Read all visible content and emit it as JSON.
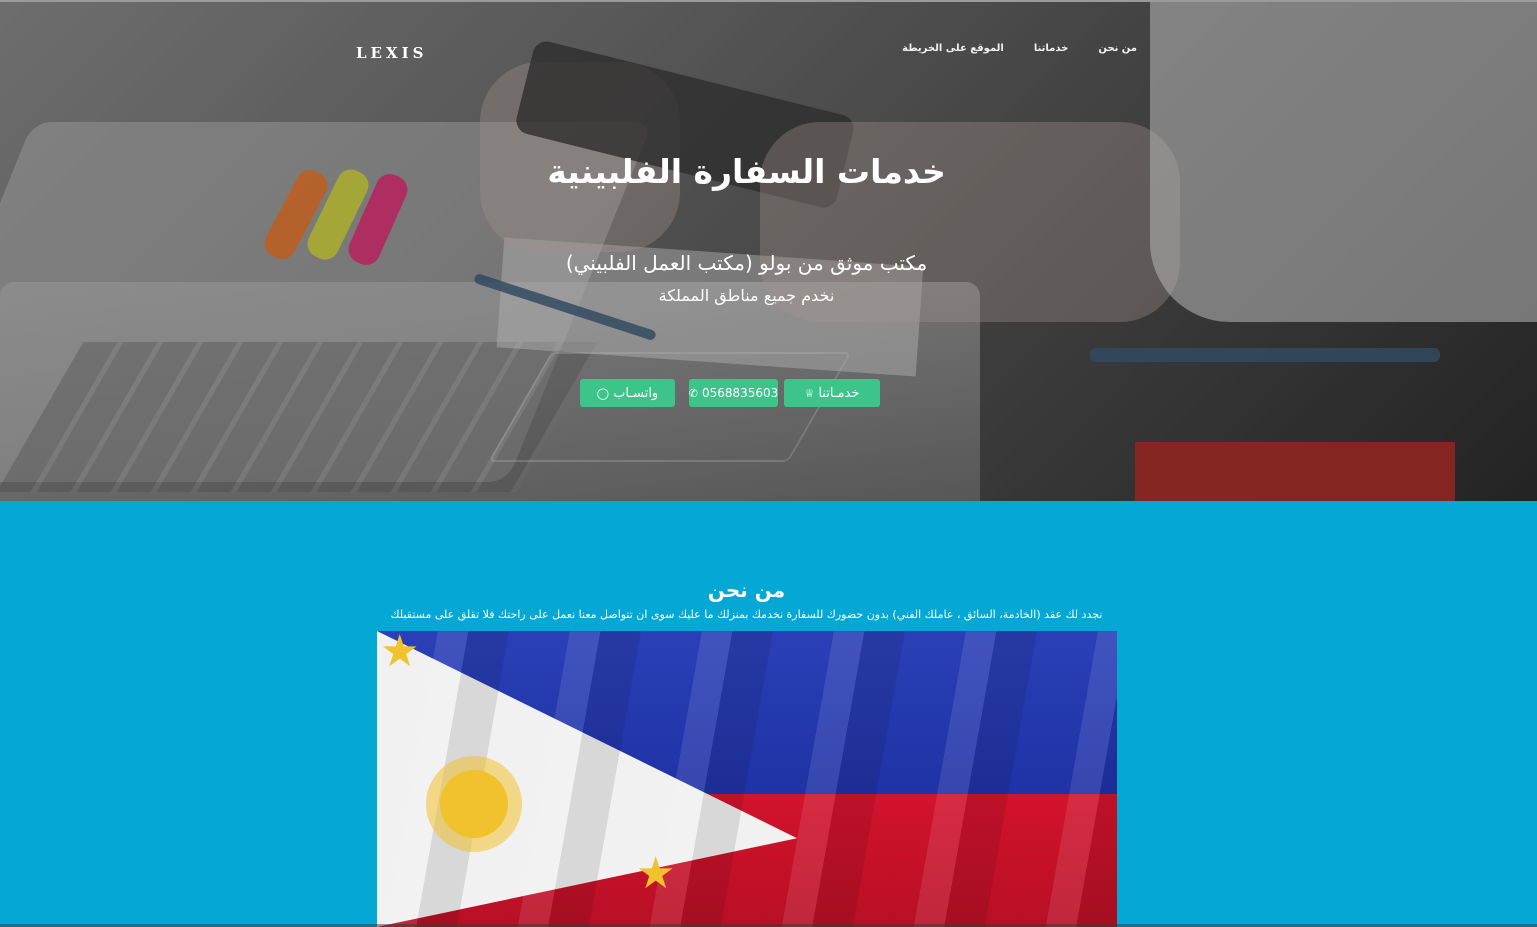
{
  "header": {
    "brand": "LEXIS",
    "nav": [
      {
        "label": "من نحن"
      },
      {
        "label": "خدماتنا"
      },
      {
        "label": "الموقع على الخريطة"
      }
    ]
  },
  "hero": {
    "title": "خدمات السفارة الفلبينية",
    "subtitle": "مكتب موثق من بولو (مكتب العمل الفلبيني)",
    "subtitle2": "نخدم جميع مناطق المملكة",
    "buttons": {
      "services": "خدمـاتنا",
      "phone": "0568835603",
      "whatsapp": "واتسـاب"
    }
  },
  "about": {
    "title": "من نحن",
    "text": "نجدد لك عقد (الخادمة، السائق ، عاملك الفني) بدون حضورك للسفارة نخدمك بمنزلك ما عليك سوى ان تتواصل معنا نعمل على راحتك فلا تقلق على مستقبلك"
  },
  "colors": {
    "about_bg": "#05a7d5",
    "button_bg": "#3cc48b"
  }
}
